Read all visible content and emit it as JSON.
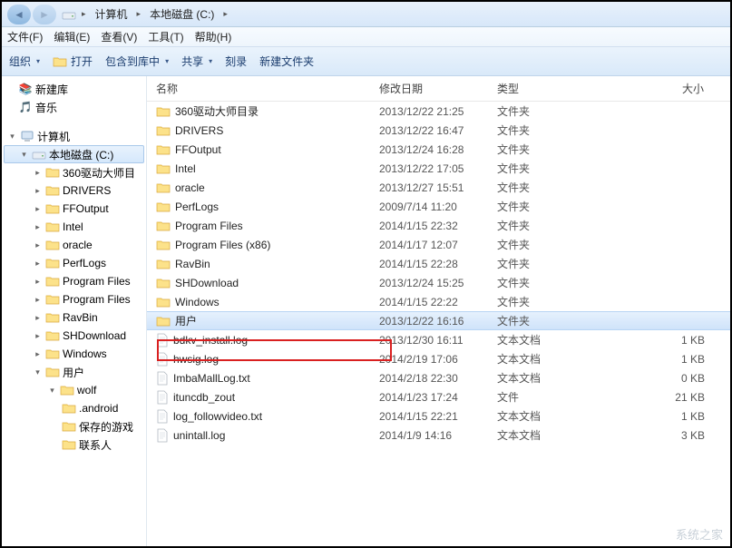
{
  "breadcrumb": {
    "root": "计算机",
    "drive": "本地磁盘 (C:)"
  },
  "menubar": {
    "file": "文件(F)",
    "edit": "编辑(E)",
    "view": "查看(V)",
    "tools": "工具(T)",
    "help": "帮助(H)"
  },
  "toolbar": {
    "organize": "组织",
    "open": "打开",
    "include": "包含到库中",
    "share": "共享",
    "burn": "刻录",
    "newfolder": "新建文件夹"
  },
  "columns": {
    "name": "名称",
    "date": "修改日期",
    "type": "类型",
    "size": "大小"
  },
  "sidebar": {
    "newlib": "新建库",
    "music": "音乐",
    "computer": "计算机",
    "drive": "本地磁盘 (C:)",
    "folders": [
      "360驱动大师目",
      "DRIVERS",
      "FFOutput",
      "Intel",
      "oracle",
      "PerfLogs",
      "Program Files",
      "Program Files",
      "RavBin",
      "SHDownload",
      "Windows",
      "用户"
    ],
    "user": "wolf",
    "userSubs": [
      ".android",
      "保存的游戏",
      "联系人"
    ]
  },
  "files": [
    {
      "name": "360驱动大师目录",
      "date": "2013/12/22 21:25",
      "type": "文件夹",
      "size": "",
      "icon": "folder"
    },
    {
      "name": "DRIVERS",
      "date": "2013/12/22 16:47",
      "type": "文件夹",
      "size": "",
      "icon": "folder"
    },
    {
      "name": "FFOutput",
      "date": "2013/12/24 16:28",
      "type": "文件夹",
      "size": "",
      "icon": "folder"
    },
    {
      "name": "Intel",
      "date": "2013/12/22 17:05",
      "type": "文件夹",
      "size": "",
      "icon": "folder"
    },
    {
      "name": "oracle",
      "date": "2013/12/27 15:51",
      "type": "文件夹",
      "size": "",
      "icon": "folder"
    },
    {
      "name": "PerfLogs",
      "date": "2009/7/14 11:20",
      "type": "文件夹",
      "size": "",
      "icon": "folder"
    },
    {
      "name": "Program Files",
      "date": "2014/1/15 22:32",
      "type": "文件夹",
      "size": "",
      "icon": "folder"
    },
    {
      "name": "Program Files (x86)",
      "date": "2014/1/17 12:07",
      "type": "文件夹",
      "size": "",
      "icon": "folder"
    },
    {
      "name": "RavBin",
      "date": "2014/1/15 22:28",
      "type": "文件夹",
      "size": "",
      "icon": "folder"
    },
    {
      "name": "SHDownload",
      "date": "2013/12/24 15:25",
      "type": "文件夹",
      "size": "",
      "icon": "folder"
    },
    {
      "name": "Windows",
      "date": "2014/1/15 22:22",
      "type": "文件夹",
      "size": "",
      "icon": "folder"
    },
    {
      "name": "用户",
      "date": "2013/12/22 16:16",
      "type": "文件夹",
      "size": "",
      "icon": "folder",
      "selected": true,
      "highlight": true
    },
    {
      "name": "bdkv_install.log",
      "date": "2013/12/30 16:11",
      "type": "文本文档",
      "size": "1 KB",
      "icon": "file"
    },
    {
      "name": "hwsig.log",
      "date": "2014/2/19 17:06",
      "type": "文本文档",
      "size": "1 KB",
      "icon": "file"
    },
    {
      "name": "ImbaMallLog.txt",
      "date": "2014/2/18 22:30",
      "type": "文本文档",
      "size": "0 KB",
      "icon": "file"
    },
    {
      "name": "ituncdb_zout",
      "date": "2014/1/23 17:24",
      "type": "文件",
      "size": "21 KB",
      "icon": "file"
    },
    {
      "name": "log_followvideo.txt",
      "date": "2014/1/15 22:21",
      "type": "文本文档",
      "size": "1 KB",
      "icon": "file"
    },
    {
      "name": "unintall.log",
      "date": "2014/1/9 14:16",
      "type": "文本文档",
      "size": "3 KB",
      "icon": "file"
    }
  ],
  "watermark": "系统之家"
}
